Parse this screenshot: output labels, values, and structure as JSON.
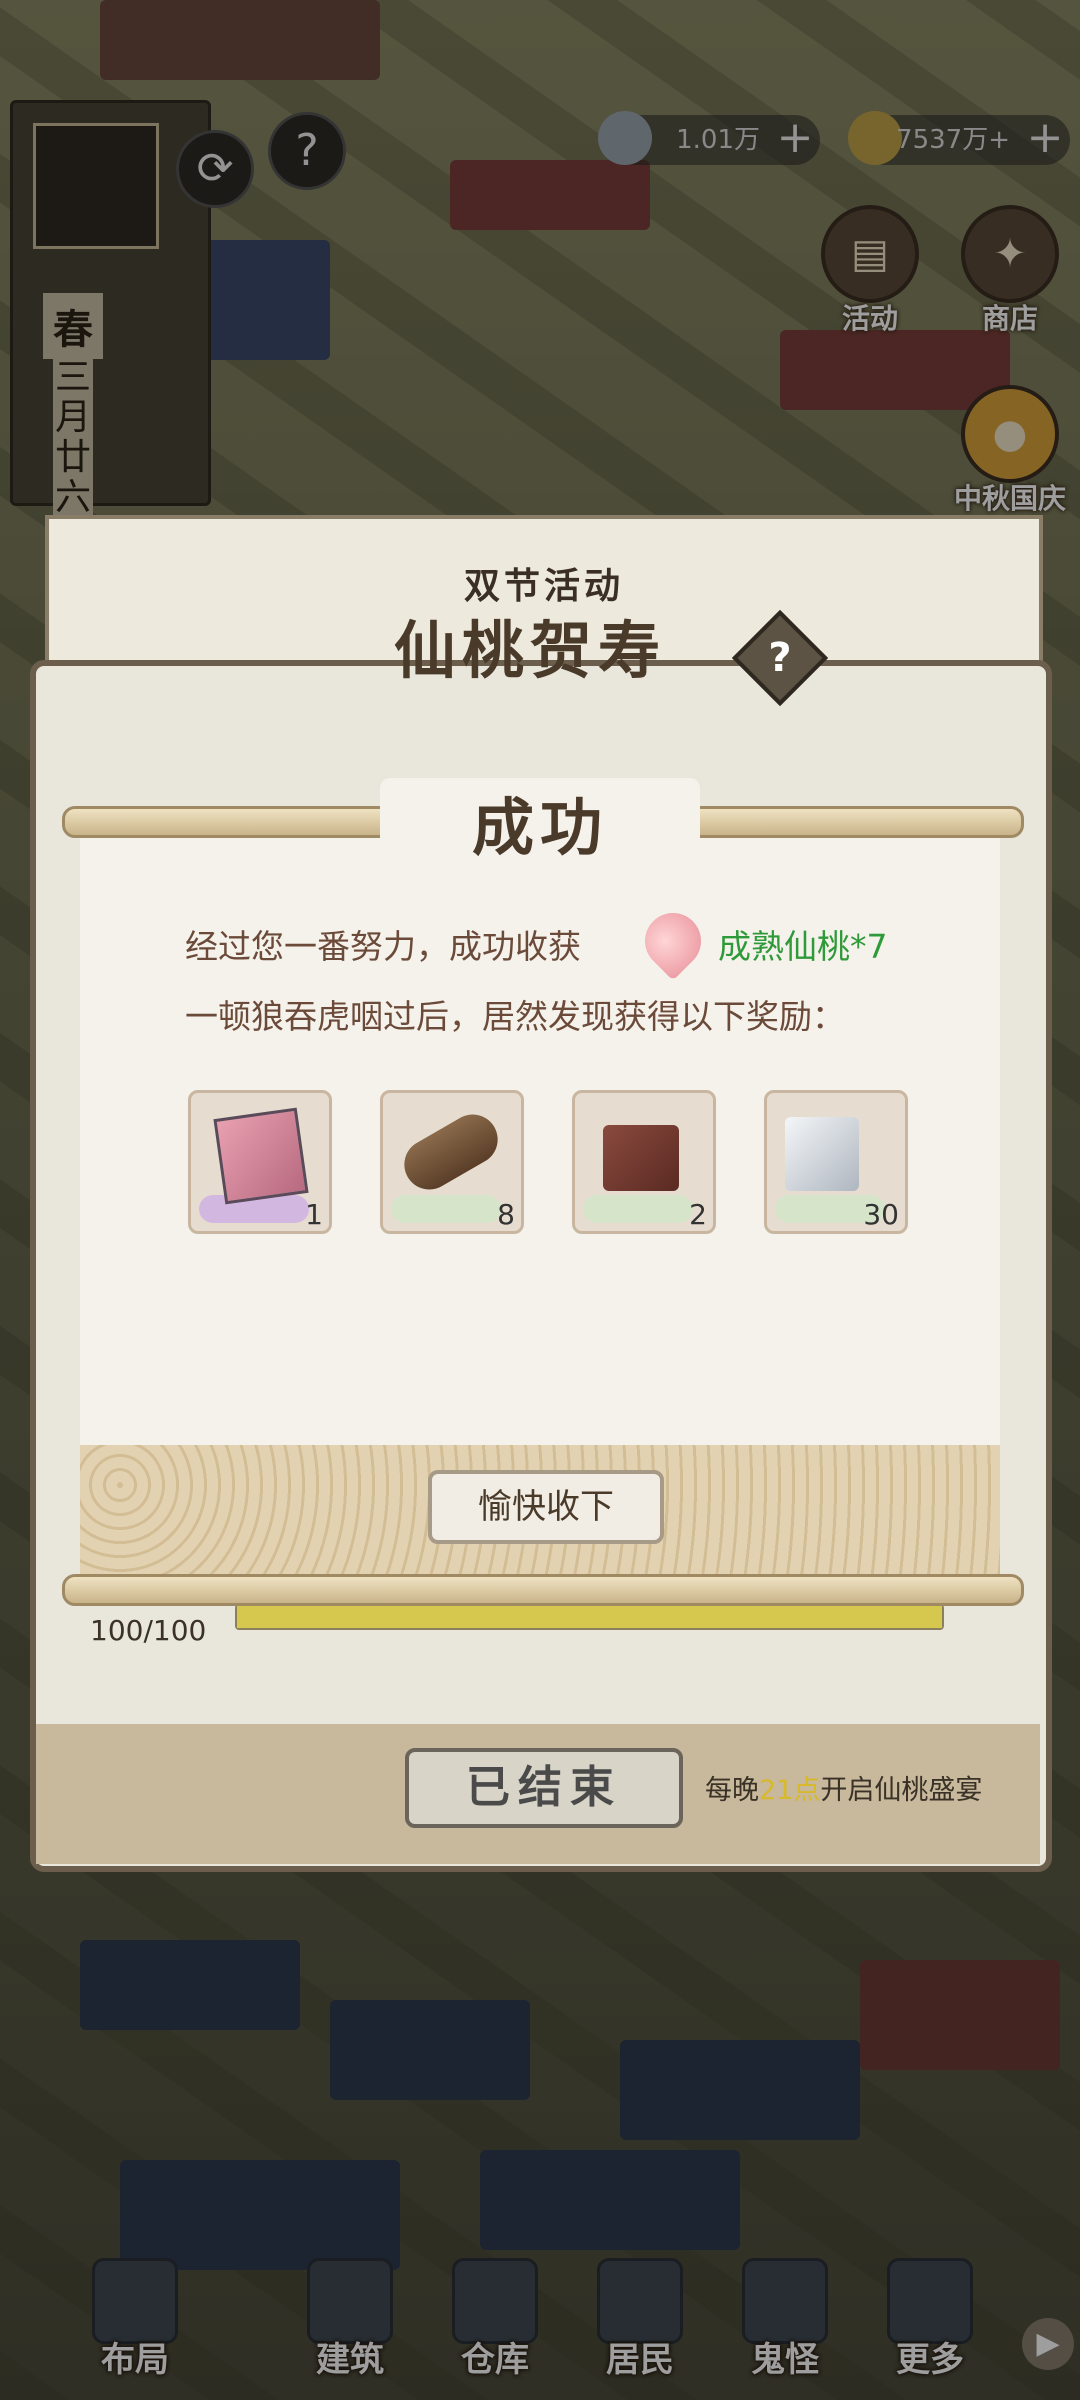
{
  "hud": {
    "resource1": {
      "value": "1.01万",
      "icon": "bowl-icon"
    },
    "resource2": {
      "value": "7537万+",
      "icon": "coin-icon"
    },
    "activity_label": "活动",
    "shop_label": "商店",
    "festival_label": "中秋国庆"
  },
  "calendar": {
    "season": "春",
    "date": "三月廿六"
  },
  "event": {
    "subtitle": "双节活动",
    "title": "仙桃贺寿",
    "progress_text": "100/100",
    "progress": 1.0,
    "ended_label": "已结束",
    "nightly_prefix": "每晚",
    "nightly_time": "21点",
    "nightly_suffix": "开启仙桃盛宴"
  },
  "popup": {
    "title": "成功",
    "line1": "经过您一番努力，成功收获",
    "fruit": "成熟仙桃*7",
    "line2": "一顿狼吞虎咽过后，居然发现获得以下奖励：",
    "rewards": [
      {
        "name": "book",
        "qty": "1",
        "glow": "#c9a8e8"
      },
      {
        "name": "wood-log",
        "qty": "8",
        "glow": "#cfe8c8"
      },
      {
        "name": "earth-block",
        "qty": "2",
        "glow": "#cfe8c8"
      },
      {
        "name": "stone-block",
        "qty": "30",
        "glow": "#cfe8c8"
      }
    ],
    "accept_label": "愉快收下"
  },
  "nav": [
    {
      "label": "布局"
    },
    {
      "label": "建筑"
    },
    {
      "label": "仓库"
    },
    {
      "label": "居民"
    },
    {
      "label": "鬼怪"
    },
    {
      "label": "更多"
    }
  ]
}
